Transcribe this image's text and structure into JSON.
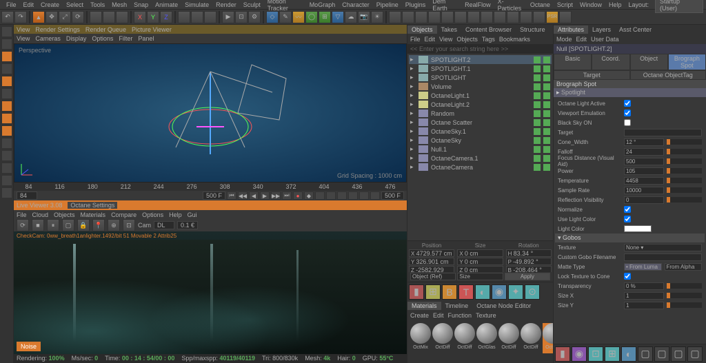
{
  "menu": {
    "items": [
      "File",
      "Edit",
      "Create",
      "Select",
      "Tools",
      "Mesh",
      "Snap",
      "Animate",
      "Simulate",
      "Render",
      "Sculpt",
      "Motion Tracker",
      "MoGraph",
      "Character",
      "Pipeline",
      "Plugins",
      "Dem Earth",
      "RealFlow",
      "X-Particles",
      "Octane",
      "Script",
      "Window",
      "Help"
    ],
    "layout_lbl": "Layout:",
    "layout_val": "Startup (User)"
  },
  "vp": {
    "tabs": [
      "View",
      "Render Settings",
      "Render Queue",
      "Picture Viewer"
    ],
    "menu": [
      "View",
      "Cameras",
      "Display",
      "Options",
      "Filter",
      "Panel"
    ],
    "label": "Perspective",
    "grid": "Grid Spacing : 1000 cm"
  },
  "tl": {
    "frames": [
      "84",
      "116",
      "180",
      "212",
      "244",
      "276",
      "308",
      "340",
      "372",
      "404",
      "436",
      "476",
      "F"
    ],
    "start": "84",
    "cur": "500 F",
    "end": "500 F"
  },
  "lv": {
    "title": "Live Viewer 3.08",
    "settings": "Octane Settings",
    "menu": [
      "File",
      "Cloud",
      "Objects",
      "Materials",
      "Compare",
      "Options",
      "Help",
      "Gui"
    ],
    "cam": "Cam",
    "dl": "DL",
    "val": "0.1 €",
    "stat": "CheckCam: 0ww_breath1anlighter.1492/bit 51 Movable 2 Attrib25",
    "noise": "Noise"
  },
  "status": {
    "rendering": "Rendering:",
    "rv": "100%",
    "ms": "Ms/sec:",
    "msv": "0",
    "time": "Time:",
    "tv": "00 : 14 : 54/00 : 00",
    "spp": "Spp/maxspp:",
    "sppv": "40119/40119",
    "mesh": "Mesh:",
    "mv": "4k",
    "hair": "Hair:",
    "hv": "0",
    "gpu": "GPU:",
    "gv": "55°C",
    "tri": "Tri: 800/830k"
  },
  "obj": {
    "tabs": [
      "Objects",
      "Takes",
      "Content Browser",
      "Structure"
    ],
    "menu": [
      "File",
      "Edit",
      "View",
      "Objects",
      "Tags",
      "Bookmarks"
    ],
    "search": "<< Enter your search string here >>",
    "tree": [
      {
        "n": "SPOTLIGHT.2",
        "ico": "sp",
        "sel": true
      },
      {
        "n": "SPOTLIGHT.1",
        "ico": "sp"
      },
      {
        "n": "SPOTLIGHT",
        "ico": "sp"
      },
      {
        "n": "Volume",
        "ico": "vol"
      },
      {
        "n": "OctaneLight.1",
        "ico": "lt"
      },
      {
        "n": "OctaneLight.2",
        "ico": "lt"
      },
      {
        "n": "Random",
        "ico": "null"
      },
      {
        "n": "Octane Scatter",
        "ico": "null"
      },
      {
        "n": "OctaneSky.1",
        "ico": "null"
      },
      {
        "n": "OctaneSky",
        "ico": "null"
      },
      {
        "n": "Null.1",
        "ico": "null"
      },
      {
        "n": "OctaneCamera.1",
        "ico": "null"
      },
      {
        "n": "OctaneCamera",
        "ico": "null"
      }
    ]
  },
  "coords": {
    "pos": "Position",
    "size": "Size",
    "rot": "Rotation",
    "r": [
      {
        "x": "4729.577 cm",
        "y": "0 cm",
        "h": "83.34 °"
      },
      {
        "x": "326.901 cm",
        "y": "0 cm",
        "p": "-49.892 °"
      },
      {
        "x": "-2582.929 cm",
        "y": "0 cm",
        "b": "-208.464 °"
      }
    ],
    "objref": "Object (Ref)",
    "sz": "Size",
    "apply": "Apply"
  },
  "att": {
    "tabs": [
      "Attributes",
      "Layers",
      "Asst Center"
    ],
    "menu": [
      "Mode",
      "Edit",
      "User Data"
    ],
    "obj": "Null [SPOTLIGHT.2]",
    "btabs": [
      "Basic",
      "Coord.",
      "Object",
      "Brograph Spot",
      "Target",
      "Octane ObjectTag"
    ],
    "sec": "Brograph Spot",
    "sub": "Spotlight",
    "params": [
      {
        "l": "Octane Light Active",
        "t": "chk",
        "v": true
      },
      {
        "l": "Viewport Emulation",
        "t": "chk",
        "v": true
      },
      {
        "l": "Black Sky ON",
        "t": "chk",
        "v": false
      },
      {
        "l": "Target",
        "t": "fld",
        "v": ""
      },
      {
        "l": "Cone_Width",
        "t": "sl",
        "v": "12 °"
      },
      {
        "l": "Falloff",
        "t": "sl",
        "v": "24"
      },
      {
        "l": "Focus Distance (Visual Aid)",
        "t": "sl",
        "v": "500"
      },
      {
        "l": "Power",
        "t": "sl",
        "v": "105"
      },
      {
        "l": "Temperature",
        "t": "sl",
        "v": "4458"
      },
      {
        "l": "Sample Rate",
        "t": "sl",
        "v": "10000"
      },
      {
        "l": "Reflection Visibility",
        "t": "sl",
        "v": "0"
      },
      {
        "l": "Normalize",
        "t": "chk",
        "v": true
      },
      {
        "l": "Use Light Color",
        "t": "chk",
        "v": true
      },
      {
        "l": "Light Color",
        "t": "col",
        "v": "#ffffff"
      }
    ],
    "sec2": "Gobos",
    "params2": [
      {
        "l": "Texture",
        "t": "dd",
        "v": "None"
      },
      {
        "l": "Custom Gobo Filename",
        "t": "fld",
        "v": ""
      },
      {
        "l": "Matte Type",
        "t": "opt",
        "v": "From Luma",
        "v2": "From Alpha"
      },
      {
        "l": "Lock Texture to Cone",
        "t": "chk",
        "v": true
      },
      {
        "l": "Transparency",
        "t": "sl",
        "v": "0 %"
      },
      {
        "l": "Size X",
        "t": "sl",
        "v": "1"
      },
      {
        "l": "Size Y",
        "t": "sl",
        "v": "1"
      }
    ]
  },
  "mat": {
    "tabs": [
      "Materials",
      "Timeline",
      "Octane Node Editor"
    ],
    "menu": [
      "Create",
      "Edit",
      "Function",
      "Texture"
    ],
    "balls": [
      "OctMix",
      "OctDiff",
      "OctDiff",
      "OctGlas",
      "OctDiff",
      "OctDiff",
      "OctMix"
    ]
  }
}
